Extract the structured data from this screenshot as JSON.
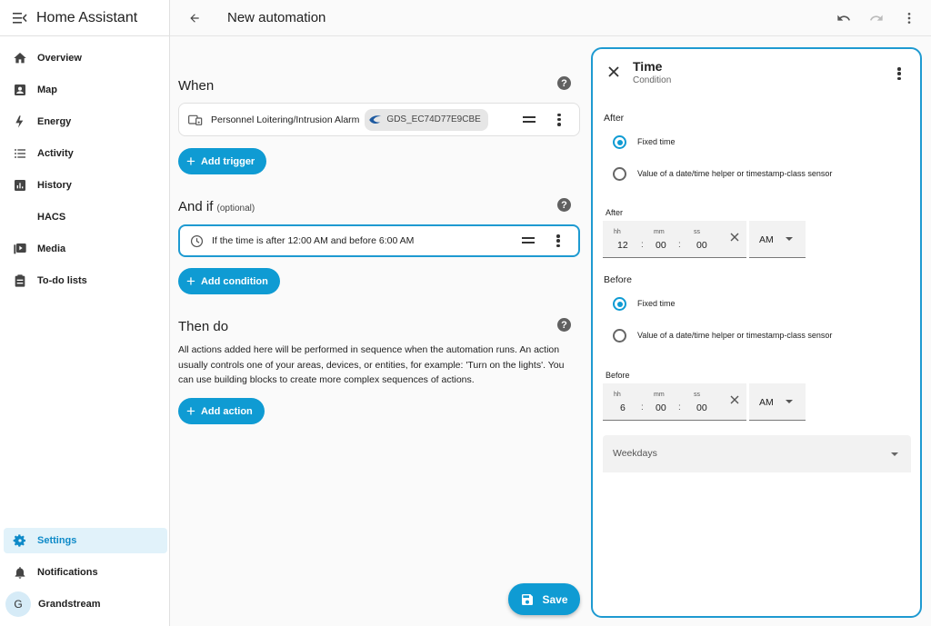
{
  "sidebar": {
    "title": "Home Assistant",
    "items": [
      {
        "label": "Overview",
        "icon": "home-icon"
      },
      {
        "label": "Map",
        "icon": "map-icon"
      },
      {
        "label": "Energy",
        "icon": "lightning-icon"
      },
      {
        "label": "Activity",
        "icon": "list-icon"
      },
      {
        "label": "History",
        "icon": "chart-icon"
      },
      {
        "label": "HACS",
        "icon": ""
      },
      {
        "label": "Media",
        "icon": "media-icon"
      },
      {
        "label": "To-do lists",
        "icon": "clipboard-icon"
      }
    ],
    "settings": "Settings",
    "notifications": "Notifications",
    "user": {
      "initial": "G",
      "name": "Grandstream"
    }
  },
  "topbar": {
    "title": "New automation"
  },
  "editor": {
    "when": {
      "title": "When",
      "trigger": {
        "label": "Personnel Loitering/Intrusion Alarm",
        "device": "GDS_EC74D77E9CBE"
      },
      "add_label": "Add trigger"
    },
    "and_if": {
      "title": "And if",
      "optional": "(optional)",
      "condition": {
        "label": "If the time is after 12:00 AM and before 6:00 AM"
      },
      "add_label": "Add condition"
    },
    "then_do": {
      "title": "Then do",
      "description": "All actions added here will be performed in sequence when the automation runs. An action usually controls one of your areas, devices, or entities, for example: 'Turn on the lights'. You can use building blocks to create more complex sequences of actions.",
      "add_label": "Add action"
    },
    "save_label": "Save"
  },
  "panel": {
    "title": "Time",
    "subtitle": "Condition",
    "after": {
      "label": "After",
      "option_fixed": "Fixed time",
      "option_helper": "Value of a date/time helper or timestamp-class sensor",
      "selected": "Fixed time",
      "field_label": "After",
      "hh_label": "hh",
      "mm_label": "mm",
      "ss_label": "ss",
      "hh": "12",
      "mm": "00",
      "ss": "00",
      "ampm": "AM"
    },
    "before": {
      "label": "Before",
      "option_fixed": "Fixed time",
      "option_helper": "Value of a date/time helper or timestamp-class sensor",
      "selected": "Fixed time",
      "field_label": "Before",
      "hh_label": "hh",
      "mm_label": "mm",
      "ss_label": "ss",
      "hh": "6",
      "mm": "00",
      "ss": "00",
      "ampm": "AM"
    },
    "weekdays_label": "Weekdays"
  },
  "colors": {
    "accent": "#0f9bd3",
    "active_bg": "#e1f2fa"
  }
}
